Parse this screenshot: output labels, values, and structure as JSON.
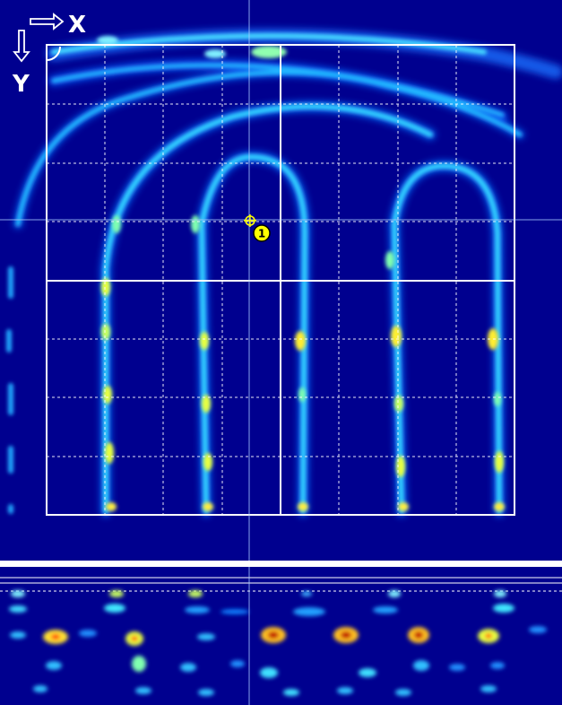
{
  "axes": {
    "x_label": "X",
    "y_label": "Y"
  },
  "marker": {
    "label": "1"
  },
  "colors": {
    "background": "#00008f",
    "grid": "#ffffff",
    "marker": "#ffff00",
    "crosshair": "#aaccff"
  },
  "icons": {
    "x_direction": "arrow-right-icon",
    "y_direction": "arrow-down-icon",
    "marker": "crosshair-target-icon"
  }
}
